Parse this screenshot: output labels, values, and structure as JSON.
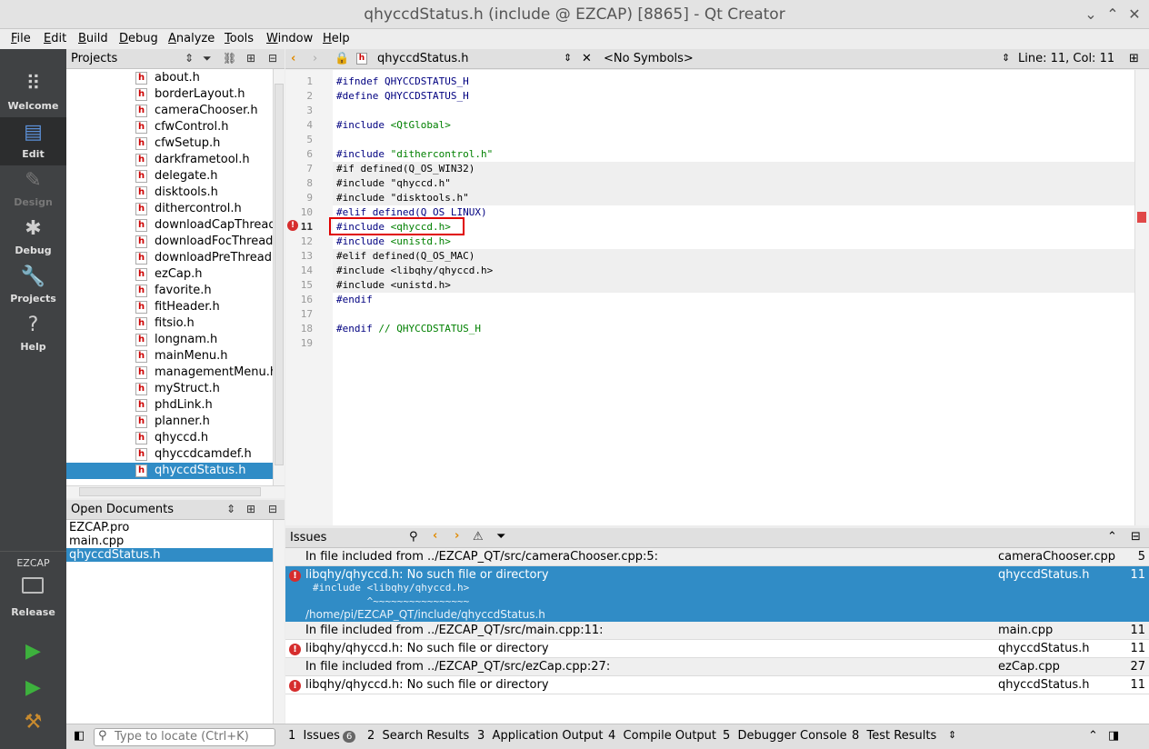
{
  "window": {
    "title": "qhyccdStatus.h (include @ EZCAP) [8865] - Qt Creator",
    "minimize": "⌄",
    "maximize": "⌃",
    "close": "✕"
  },
  "menu": [
    "File",
    "Edit",
    "Build",
    "Debug",
    "Analyze",
    "Tools",
    "Window",
    "Help"
  ],
  "modes": [
    {
      "label": "Welcome",
      "icon": "grid-icon"
    },
    {
      "label": "Edit",
      "icon": "edit-icon"
    },
    {
      "label": "Design",
      "icon": "pen-icon"
    },
    {
      "label": "Debug",
      "icon": "bug-icon"
    },
    {
      "label": "Projects",
      "icon": "wrench-icon"
    },
    {
      "label": "Help",
      "icon": "question-icon"
    }
  ],
  "kit": {
    "project": "EZCAP",
    "build": "Release"
  },
  "projects_pane": {
    "title": "Projects",
    "files": [
      "about.h",
      "borderLayout.h",
      "cameraChooser.h",
      "cfwControl.h",
      "cfwSetup.h",
      "darkframetool.h",
      "delegate.h",
      "disktools.h",
      "dithercontrol.h",
      "downloadCapThread.h",
      "downloadFocThread.h",
      "downloadPreThread.h",
      "ezCap.h",
      "favorite.h",
      "fitHeader.h",
      "fitsio.h",
      "longnam.h",
      "mainMenu.h",
      "managementMenu.h",
      "myStruct.h",
      "phdLink.h",
      "planner.h",
      "qhyccd.h",
      "qhyccdcamdef.h",
      "qhyccdStatus.h"
    ],
    "selected": "qhyccdStatus.h"
  },
  "open_docs": {
    "title": "Open Documents",
    "items": [
      "EZCAP.pro",
      "main.cpp",
      "qhyccdStatus.h"
    ],
    "selected": "qhyccdStatus.h"
  },
  "editor": {
    "filename": "qhyccdStatus.h",
    "symbols": "<No Symbols>",
    "position": "Line: 11, Col: 11",
    "lines": [
      {
        "n": "1",
        "pp": "#ifndef QHYCCDSTATUS_H",
        "rest": "",
        "inactive": false
      },
      {
        "n": "2",
        "pp": "#define QHYCCDSTATUS_H",
        "rest": "",
        "inactive": false
      },
      {
        "n": "3",
        "pp": "",
        "rest": "",
        "inactive": false
      },
      {
        "n": "4",
        "pp": "#include ",
        "rest": "<QtGlobal>",
        "inactive": false
      },
      {
        "n": "5",
        "pp": "",
        "rest": "",
        "inactive": false
      },
      {
        "n": "6",
        "pp": "#include ",
        "rest": "\"dithercontrol.h\"",
        "inactive": false
      },
      {
        "n": "7",
        "pp": "#if defined(Q_OS_WIN32)",
        "rest": "",
        "inactive": true
      },
      {
        "n": "8",
        "pp": "#include \"qhyccd.h\"",
        "rest": "",
        "inactive": true
      },
      {
        "n": "9",
        "pp": "#include \"disktools.h\"",
        "rest": "",
        "inactive": true
      },
      {
        "n": "10",
        "pp": "#elif defined(Q_OS_LINUX)",
        "rest": "",
        "inactive": false
      },
      {
        "n": "11",
        "pp": "#include ",
        "rest": "<qhyccd.h>",
        "inactive": false
      },
      {
        "n": "12",
        "pp": "#include ",
        "rest": "<unistd.h>",
        "inactive": false
      },
      {
        "n": "13",
        "pp": "#elif defined(Q_OS_MAC)",
        "rest": "",
        "inactive": true
      },
      {
        "n": "14",
        "pp": "#include <libqhy/qhyccd.h>",
        "rest": "",
        "inactive": true
      },
      {
        "n": "15",
        "pp": "#include <unistd.h>",
        "rest": "",
        "inactive": true
      },
      {
        "n": "16",
        "pp": "#endif",
        "rest": "",
        "inactive": false
      },
      {
        "n": "17",
        "pp": "",
        "rest": "",
        "inactive": false
      },
      {
        "n": "18",
        "pp": "#endif ",
        "rest": "// QHYCCDSTATUS_H",
        "inactive": false
      },
      {
        "n": "19",
        "pp": "",
        "rest": "",
        "inactive": false
      }
    ]
  },
  "issues": {
    "title": "Issues",
    "rows": [
      {
        "type": "info",
        "msg": "In file included from ../EZCAP_QT/src/cameraChooser.cpp:5:",
        "file": "cameraChooser.cpp",
        "line": "5"
      },
      {
        "type": "error",
        "msg": "libqhy/qhyccd.h: No such file or directory",
        "file": "qhyccdStatus.h",
        "line": "11",
        "sub1": "#include <libqhy/qhyccd.h>",
        "sub2": "         ^~~~~~~~~~~~~~~~~",
        "sub3": "/home/pi/EZCAP_QT/include/qhyccdStatus.h"
      },
      {
        "type": "info",
        "msg": "In file included from ../EZCAP_QT/src/main.cpp:11:",
        "file": "main.cpp",
        "line": "11"
      },
      {
        "type": "error",
        "msg": "libqhy/qhyccd.h: No such file or directory",
        "file": "qhyccdStatus.h",
        "line": "11"
      },
      {
        "type": "info",
        "msg": "In file included from ../EZCAP_QT/src/ezCap.cpp:27:",
        "file": "ezCap.cpp",
        "line": "27"
      },
      {
        "type": "error",
        "msg": "libqhy/qhyccd.h: No such file or directory",
        "file": "qhyccdStatus.h",
        "line": "11"
      }
    ]
  },
  "statusbar": {
    "locator_placeholder": "Type to locate (Ctrl+K)",
    "tabs": [
      {
        "num": "1",
        "label": "Issues",
        "badge": "6"
      },
      {
        "num": "2",
        "label": "Search Results"
      },
      {
        "num": "3",
        "label": "Application Output"
      },
      {
        "num": "4",
        "label": "Compile Output"
      },
      {
        "num": "5",
        "label": "Debugger Console"
      },
      {
        "num": "8",
        "label": "Test Results"
      }
    ]
  },
  "colors": {
    "selection": "#308cc6",
    "modebar": "#404244",
    "error": "#d62d2d",
    "highlight_box": "#e00000"
  }
}
